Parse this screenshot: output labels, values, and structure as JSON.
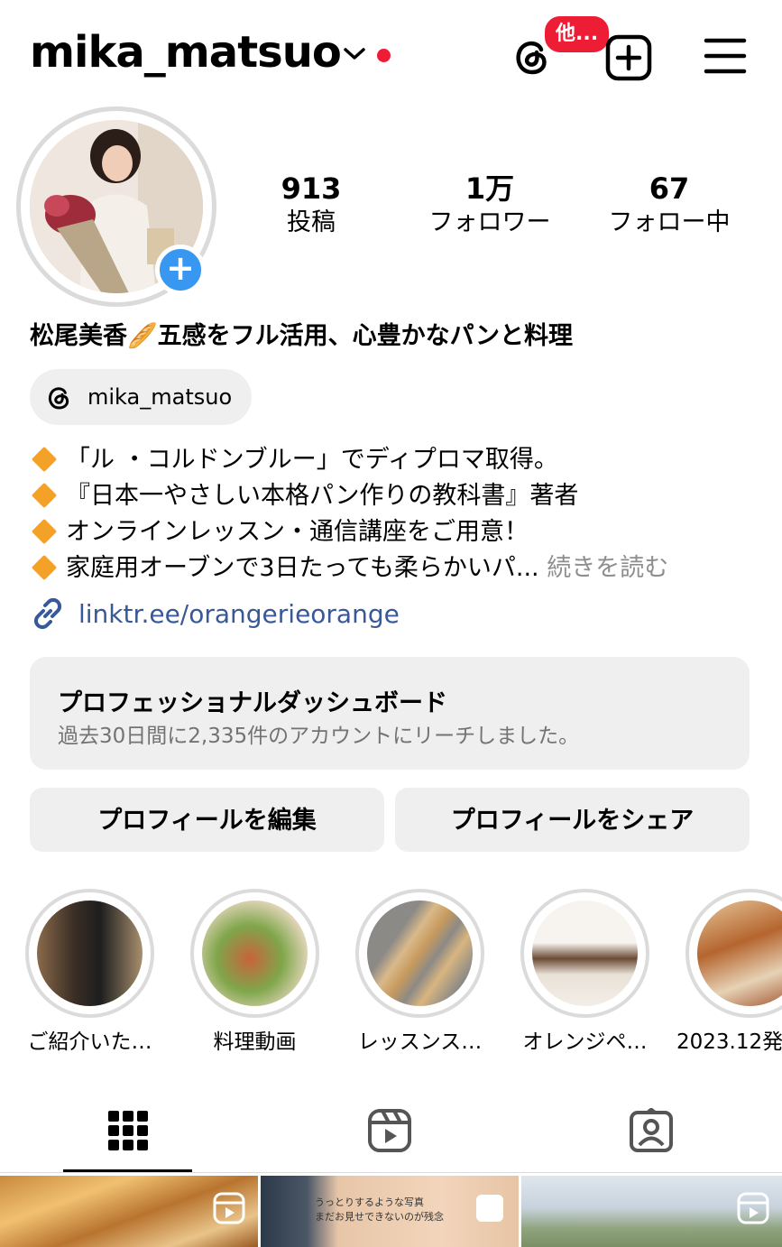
{
  "header": {
    "username": "mika_matsuo",
    "threads_badge": "他..."
  },
  "stats": [
    {
      "value": "913",
      "label": "投稿"
    },
    {
      "value": "1万",
      "label": "フォロワー"
    },
    {
      "value": "67",
      "label": "フォロー中"
    }
  ],
  "bio": {
    "full_name": "松尾美香🥖五感をフル活用、心豊かなパンと料理",
    "threads_handle": "mika_matsuo",
    "lines": [
      "「ル ・コルドンブルー」でディプロマ取得。",
      "『日本一やさしい本格パン作りの教科書』著者",
      "オンラインレッスン・通信講座をご用意！",
      "家庭用オーブンで3日たっても柔らかいパ..."
    ],
    "more": "続きを読む",
    "link": "linktr.ee/orangerieorange"
  },
  "dashboard": {
    "title": "プロフェッショナルダッシュボード",
    "subtitle": "過去30日間に2,335件のアカウントにリーチしました。"
  },
  "buttons": {
    "edit": "プロフィールを編集",
    "share": "プロフィールをシェア"
  },
  "highlights": [
    {
      "label": "ご紹介いた…"
    },
    {
      "label": "料理動画"
    },
    {
      "label": "レッスンス…"
    },
    {
      "label": "オレンジペ…"
    },
    {
      "label": "2023.12発"
    }
  ],
  "grid_preview": {
    "post2_caption": "うっとりするような写真\nまだお見せできないのが残念"
  },
  "colors": {
    "link": "#385898",
    "badge": "#ee1d36",
    "accent_blue": "#3897f0",
    "diamond": "#f4a127"
  },
  "icons": [
    "threads-icon",
    "new-post-icon",
    "hamburger-menu-icon",
    "grid-icon",
    "reels-icon",
    "tagged-icon",
    "link-icon",
    "diamond-icon"
  ]
}
